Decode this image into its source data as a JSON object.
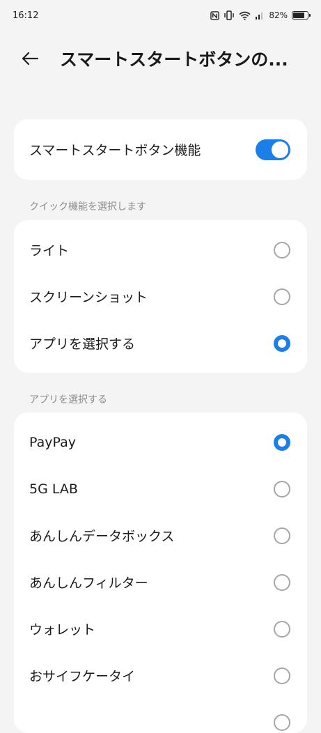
{
  "status_bar": {
    "time": "16:12",
    "battery_percent": "82%",
    "battery_level": 0.82,
    "icons": [
      "nfc-icon",
      "vibrate-icon",
      "wifi-icon",
      "signal-icon",
      "battery-icon"
    ]
  },
  "header": {
    "back_icon": "arrow-left-icon",
    "title": "スマートスタートボタンの..."
  },
  "main_toggle": {
    "label": "スマートスタートボタン機能",
    "enabled": true
  },
  "quick_section": {
    "label": "クイック機能を選択します",
    "options": [
      {
        "label": "ライト",
        "selected": false
      },
      {
        "label": "スクリーンショット",
        "selected": false
      },
      {
        "label": "アプリを選択する",
        "selected": true
      }
    ]
  },
  "app_section": {
    "label": "アプリを選択する",
    "options": [
      {
        "label": "PayPay",
        "selected": true
      },
      {
        "label": "5G LAB",
        "selected": false
      },
      {
        "label": "あんしんデータボックス",
        "selected": false
      },
      {
        "label": "あんしんフィルター",
        "selected": false
      },
      {
        "label": "ウォレット",
        "selected": false
      },
      {
        "label": "おサイフケータイ",
        "selected": false
      }
    ]
  },
  "colors": {
    "accent": "#1a7fe8",
    "background": "#f4f4f4",
    "card": "#ffffff",
    "secondary_text": "#8c8c8c"
  }
}
